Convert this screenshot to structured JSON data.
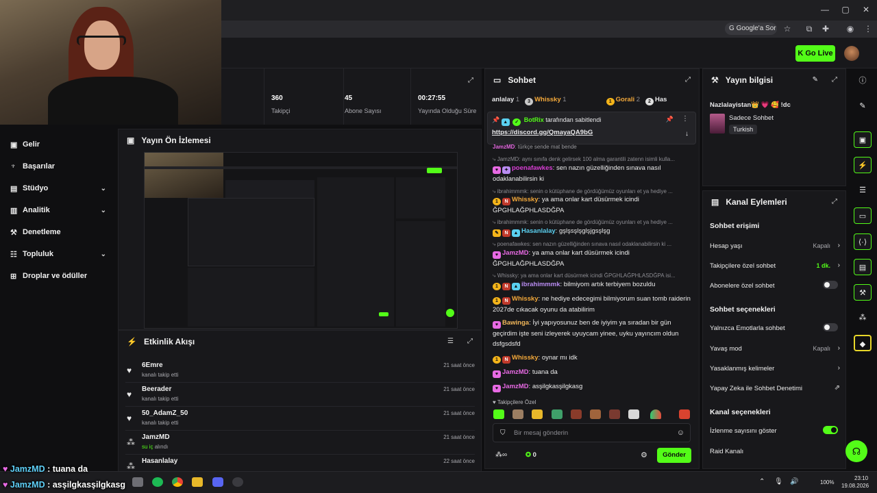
{
  "browser": {
    "google_sor": "Google'a Sor",
    "minimize": "—",
    "restore": "▢",
    "close": "✕"
  },
  "header": {
    "go_live": "Go Live"
  },
  "sidebar": {
    "items": [
      {
        "label": "Gelir",
        "icon": "wallet-icon"
      },
      {
        "label": "Başarılar",
        "icon": "trophy-icon"
      },
      {
        "label": "Stüdyo",
        "icon": "studio-icon",
        "chevron": true
      },
      {
        "label": "Analitik",
        "icon": "analytics-icon",
        "chevron": true
      },
      {
        "label": "Denetleme",
        "icon": "wrench-icon"
      },
      {
        "label": "Topluluk",
        "icon": "community-icon",
        "chevron": true
      },
      {
        "label": "Droplar ve ödüller",
        "icon": "gift-icon"
      }
    ]
  },
  "stats": [
    {
      "value": "360",
      "label": "Takipçi"
    },
    {
      "value": "45",
      "label": "Abone Sayısı"
    },
    {
      "value": "00:27:55",
      "label": "Yayında Olduğu Süre"
    }
  ],
  "preview": {
    "title": "Yayın Ön İzlemesi"
  },
  "activity": {
    "title": "Etkinlik Akışı",
    "items": [
      {
        "name": "6Emre",
        "desc": "kanalı takip etti",
        "time": "21 saat önce",
        "icon": "heart-icon"
      },
      {
        "name": "Beerader",
        "desc": "kanalı takip etti",
        "time": "21 saat önce",
        "icon": "heart-icon"
      },
      {
        "name": "50_AdamZ_50",
        "desc": "kanalı takip etti",
        "time": "21 saat önce",
        "icon": "heart-icon"
      },
      {
        "name": "JamzMD",
        "desc_highlight": "su iç",
        "desc": "alındı",
        "time": "21 saat önce",
        "icon": "points-icon"
      },
      {
        "name": "Hasanlalay",
        "desc": "",
        "time": "22 saat önce",
        "icon": "points-icon"
      }
    ]
  },
  "chat": {
    "title": "Sohbet",
    "top_bar": [
      {
        "name": "anlalay",
        "count": "1"
      },
      {
        "name": "Whissky",
        "count": "1",
        "rank": "3"
      },
      {
        "name": "Gorali",
        "count": "2",
        "rank": "1"
      },
      {
        "name": "Has",
        "rank": "2"
      }
    ],
    "pinned": {
      "by": "BotRix",
      "by_suffix": "tarafından sabitlendi",
      "link": "https://discord.gg/QmayaQA9bG"
    },
    "messages": [
      {
        "type": "msg",
        "user": "JamzMD",
        "cls": "u-jamz",
        "text": "türkçe sende mat bende"
      },
      {
        "type": "reply",
        "text": "JamzMD: aynı sınıfa denk gelirsek 100 alma garantili zatenn isimli kulla..."
      },
      {
        "type": "msg",
        "user": "poenafawkes",
        "cls": "u-poena",
        "text": "sen nazın güzelliğinden sınava nasıl odaklanabilirsin ki"
      },
      {
        "type": "reply",
        "text": "ibrahimmmk: senin o kütüphane de gördüğümüz oyunları et ya hediye ..."
      },
      {
        "type": "msg",
        "user": "Whissky",
        "cls": "u-whissky",
        "text": "ya ama onlar kart düsürmek icindi ĞPGHLAĞPHLASDĞPA"
      },
      {
        "type": "reply",
        "text": "ibrahimmmk: senin o kütüphane de gördüğümüz oyunları et ya hediye ..."
      },
      {
        "type": "msg",
        "user": "Hasanlalay",
        "cls": "u-hasan",
        "text": "gşlşsşlşglşjgsşlşg"
      },
      {
        "type": "reply",
        "text": "poenafawkes: sen nazın güzelliğinden sınava nasıl odaklanabilirsin ki ..."
      },
      {
        "type": "msg",
        "user": "JamzMD",
        "cls": "u-jamz",
        "text": "ya ama onlar kart düsürmek icindi ĞPGHLAĞPHLASDĞPA"
      },
      {
        "type": "reply",
        "text": "Whissky: ya ama onlar kart düsürmek icindi ĞPGHLAĞPHLASDĞPA isi..."
      },
      {
        "type": "msg",
        "user": "ibrahimmmk",
        "cls": "u-ibra",
        "text": "bilmiyom artık terbiyem bozuldu"
      },
      {
        "type": "msg",
        "user": "Whissky",
        "cls": "u-whissky",
        "text": "ne hediye edecegimi bilmiyorum suan tomb raiderin 2027de cıkacak oyunu da atabilirim"
      },
      {
        "type": "msg",
        "user": "Bawinga",
        "cls": "u-bawinga",
        "text": "İyi yapıyosunuz ben de iyiyim ya sıradan bir gün geçirdim işte seni izleyerek uyuycam yinee, uyku yayıncım oldun dsfgsdsfd"
      },
      {
        "type": "msg",
        "user": "Whissky",
        "cls": "u-whissky",
        "text": "oynar mı idk"
      },
      {
        "type": "msg",
        "user": "JamzMD",
        "cls": "u-jamz",
        "text": "tuana da"
      },
      {
        "type": "msg",
        "user": "JamzMD",
        "cls": "u-jamz",
        "text": "asşilgkasşilgkasg"
      }
    ],
    "followers_only": "Takipçilere Özel",
    "input_placeholder": "Bir mesaj gönderin",
    "points_count": "0",
    "send_label": "Gönder"
  },
  "stream_info": {
    "title": "Yayın bilgisi",
    "stream_title": "Nazlalayistan👑 💗 🥰 !dc",
    "category": "Sadece Sohbet",
    "tag": "Turkish"
  },
  "channel_actions": {
    "title": "Kanal Eylemleri",
    "sections": [
      {
        "heading": "Sohbet erişimi",
        "rows": [
          {
            "label": "Hesap yaşı",
            "value": "Kapalı",
            "control": "chevron"
          },
          {
            "label": "Takipçilere özel sohbet",
            "value": "1 dk.",
            "control": "chevron",
            "value_green": true
          },
          {
            "label": "Abonelere özel sohbet",
            "control": "toggle",
            "on": false
          }
        ]
      },
      {
        "heading": "Sohbet seçenekleri",
        "rows": [
          {
            "label": "Yalnızca Emotlarla sohbet",
            "control": "toggle",
            "on": false
          },
          {
            "label": "Yavaş mod",
            "value": "Kapalı",
            "control": "chevron"
          },
          {
            "label": "Yasaklanmış kelimeler",
            "control": "chevron"
          },
          {
            "label": "Yapay Zeka ile Sohbet Denetimi",
            "control": "external"
          }
        ]
      },
      {
        "heading": "Kanal seçenekleri",
        "rows": [
          {
            "label": "İzlenme sayısını göster",
            "control": "toggle",
            "on": true
          },
          {
            "label": "Raid Kanalı",
            "control": "none"
          }
        ]
      }
    ]
  },
  "overlay_chat": [
    {
      "user": "JamzMD",
      "text": " : tuana da"
    },
    {
      "user": "JamzMD",
      "text": " : asşilgkasşilgkasg"
    }
  ],
  "system_tray": {
    "battery": "100%",
    "time": "23:10",
    "date": "19.08.2026"
  },
  "colors": {
    "accent": "#53fc18",
    "panel": "#18181b",
    "background": "#0f0f11"
  }
}
